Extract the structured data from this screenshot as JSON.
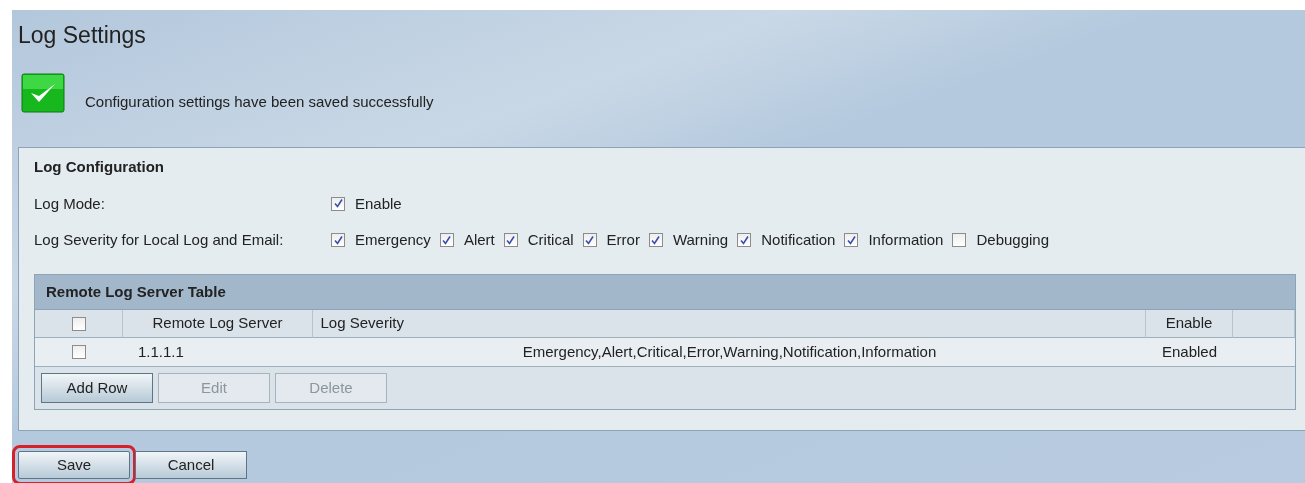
{
  "page_title": "Log Settings",
  "message": {
    "kind": "success",
    "text": "Configuration settings have been saved successfully"
  },
  "log_configuration": {
    "title": "Log Configuration",
    "log_mode": {
      "label": "Log Mode:",
      "options": [
        {
          "label": "Enable",
          "checked": true
        }
      ]
    },
    "log_severity": {
      "label": "Log Severity for Local Log and Email:",
      "options": [
        {
          "label": "Emergency",
          "checked": true
        },
        {
          "label": "Alert",
          "checked": true
        },
        {
          "label": "Critical",
          "checked": true
        },
        {
          "label": "Error",
          "checked": true
        },
        {
          "label": "Warning",
          "checked": true
        },
        {
          "label": "Notification",
          "checked": true
        },
        {
          "label": "Information",
          "checked": true
        },
        {
          "label": "Debugging",
          "checked": false
        }
      ]
    }
  },
  "remote_table": {
    "title": "Remote Log Server Table",
    "select_all_checked": false,
    "columns": [
      "Remote Log Server",
      "Log Severity",
      "Enable"
    ],
    "rows": [
      {
        "checked": false,
        "server": "1.1.1.1",
        "severity": "Emergency,Alert,Critical,Error,Warning,Notification,Information",
        "enable": "Enabled"
      }
    ],
    "buttons": [
      {
        "label": "Add Row",
        "disabled": false
      },
      {
        "label": "Edit",
        "disabled": true
      },
      {
        "label": "Delete",
        "disabled": true
      }
    ]
  },
  "buttons": [
    {
      "label": "Save",
      "highlighted": true
    },
    {
      "label": "Cancel",
      "highlighted": false
    }
  ]
}
